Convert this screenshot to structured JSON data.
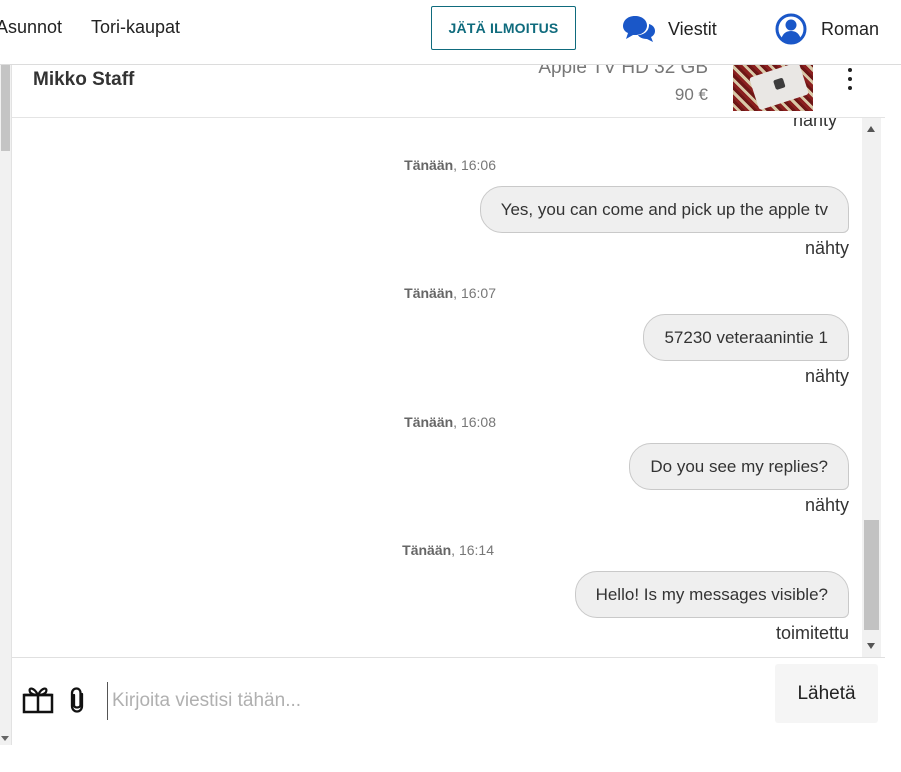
{
  "nav": {
    "asunnot": "Asunnot",
    "tori_kaupat": "Tori-kaupat",
    "post_ad": "JÄTÄ ILMOITUS",
    "messages": "Viestit",
    "user": "Roman"
  },
  "conversation": {
    "contact_name": "Mikko Staff",
    "item_title": "Apple TV HD 32 GB",
    "item_price": "90 €",
    "partial_status": "nähty",
    "messages": [
      {
        "day": "Tänään",
        "time": ", 16:06",
        "text": "Yes, you can come and pick up the apple tv",
        "status": "nähty"
      },
      {
        "day": "Tänään",
        "time": ", 16:07",
        "text": "57230 veteraanintie 1",
        "status": "nähty"
      },
      {
        "day": "Tänään",
        "time": ", 16:08",
        "text": "Do you see my replies?",
        "status": "nähty"
      },
      {
        "day": "Tänään",
        "time": ", 16:14",
        "text": "Hello! Is my messages visible?",
        "status": "toimitettu"
      }
    ]
  },
  "composer": {
    "placeholder": "Kirjoita viestisi tähän...",
    "send_label": "Lähetä"
  },
  "icons": {
    "messages": "chat-bubbles-icon",
    "user": "user-avatar-icon",
    "menu": "kebab-menu-icon",
    "gift": "gift-icon",
    "attach": "paperclip-icon"
  },
  "colors": {
    "accent": "#0f6b7d",
    "icon_blue": "#1a57c8",
    "bubble_bg": "#efefef"
  }
}
